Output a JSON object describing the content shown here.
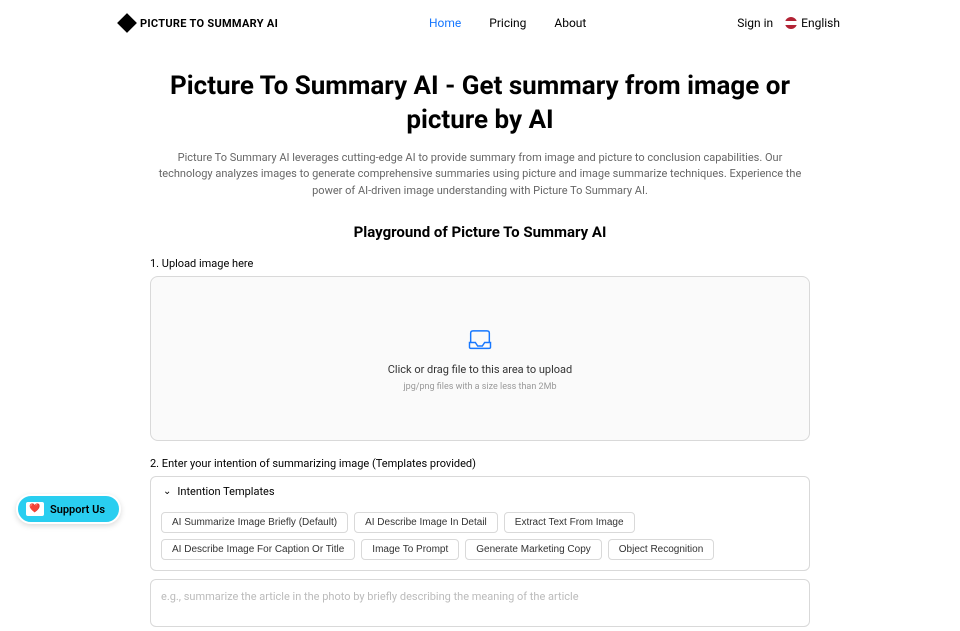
{
  "brand": "PICTURE TO SUMMARY AI",
  "nav": {
    "home": "Home",
    "pricing": "Pricing",
    "about": "About"
  },
  "auth": {
    "signin": "Sign in",
    "language": "English"
  },
  "hero": {
    "title": "Picture To Summary AI - Get summary from image or picture by AI",
    "subtitle": "Picture To Summary AI leverages cutting-edge AI to provide summary from image and picture to conclusion capabilities. Our technology analyzes images to generate comprehensive summaries using picture and image summarize techniques. Experience the power of AI-driven image understanding with Picture To Summary AI."
  },
  "playground": {
    "title": "Playground of Picture To Summary AI",
    "step1_label": "1. Upload image here",
    "upload_text": "Click or drag file to this area to upload",
    "upload_hint": "jpg/png files with a size less than 2Mb",
    "step2_label": "2. Enter your intention of summarizing image (Templates provided)",
    "templates_header": "Intention Templates",
    "templates": [
      "AI Summarize Image Briefly (Default)",
      "AI Describe Image In Detail",
      "Extract Text From Image",
      "AI Describe Image For Caption Or Title",
      "Image To Prompt",
      "Generate Marketing Copy",
      "Object Recognition"
    ],
    "intention_placeholder": "e.g., summarize the article in the photo by briefly describing the meaning of the article"
  },
  "support": "Support Us"
}
